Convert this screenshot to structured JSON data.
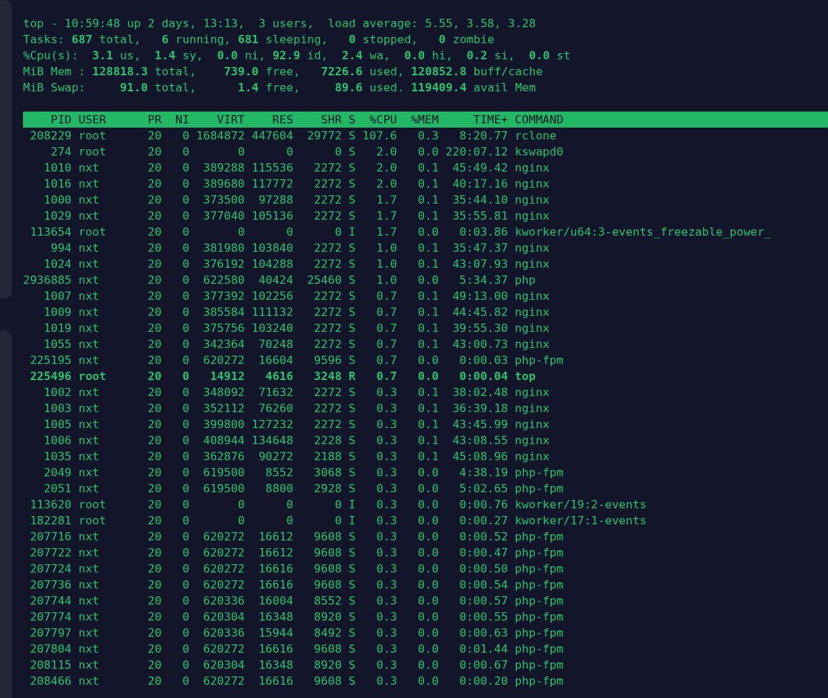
{
  "summary": [
    "top - 10:59:48 up 2 days, 13:13,  3 users,  load average: 5.55, 3.58, 3.28",
    "Tasks: **687** total,   **6** running, **681** sleeping,   **0** stopped,   **0** zombie",
    "%Cpu(s):  **3.1** us,  **1.4** sy,  **0.0** ni, **92.9** id,  **2.4** wa,  **0.0** hi,  **0.2** si,  **0.0** st",
    "MiB Mem : **128818.3** total,    **739.0** free,   **7226.6** used, **120852.8** buff/cache",
    "MiB Swap:     **91.0** total,      **1.4** free,     **89.6** used. **119409.4** avail Mem"
  ],
  "table": {
    "columns": [
      "PID",
      "USER",
      "PR",
      "NI",
      "VIRT",
      "RES",
      "SHR",
      "S",
      "%CPU",
      "%MEM",
      "TIME+",
      "COMMAND"
    ],
    "rows": [
      {
        "bold": false,
        "cells": [
          "208229",
          "root",
          "20",
          "0",
          "1684872",
          "447604",
          "29772",
          "S",
          "107.6",
          "0.3",
          "8:20.77",
          "rclone"
        ]
      },
      {
        "bold": false,
        "cells": [
          "274",
          "root",
          "20",
          "0",
          "0",
          "0",
          "0",
          "S",
          "2.0",
          "0.0",
          "220:07.12",
          "kswapd0"
        ]
      },
      {
        "bold": false,
        "cells": [
          "1010",
          "nxt",
          "20",
          "0",
          "389288",
          "115536",
          "2272",
          "S",
          "2.0",
          "0.1",
          "45:49.42",
          "nginx"
        ]
      },
      {
        "bold": false,
        "cells": [
          "1016",
          "nxt",
          "20",
          "0",
          "389680",
          "117772",
          "2272",
          "S",
          "2.0",
          "0.1",
          "40:17.16",
          "nginx"
        ]
      },
      {
        "bold": false,
        "cells": [
          "1000",
          "nxt",
          "20",
          "0",
          "373500",
          "97288",
          "2272",
          "S",
          "1.7",
          "0.1",
          "35:44.10",
          "nginx"
        ]
      },
      {
        "bold": false,
        "cells": [
          "1029",
          "nxt",
          "20",
          "0",
          "377040",
          "105136",
          "2272",
          "S",
          "1.7",
          "0.1",
          "35:55.81",
          "nginx"
        ]
      },
      {
        "bold": false,
        "cells": [
          "113654",
          "root",
          "20",
          "0",
          "0",
          "0",
          "0",
          "I",
          "1.7",
          "0.0",
          "0:03.86",
          "kworker/u64:3-events_freezable_power_"
        ]
      },
      {
        "bold": false,
        "cells": [
          "994",
          "nxt",
          "20",
          "0",
          "381980",
          "103840",
          "2272",
          "S",
          "1.0",
          "0.1",
          "35:47.37",
          "nginx"
        ]
      },
      {
        "bold": false,
        "cells": [
          "1024",
          "nxt",
          "20",
          "0",
          "376192",
          "104288",
          "2272",
          "S",
          "1.0",
          "0.1",
          "43:07.93",
          "nginx"
        ]
      },
      {
        "bold": false,
        "cells": [
          "2936885",
          "nxt",
          "20",
          "0",
          "622580",
          "40424",
          "25460",
          "S",
          "1.0",
          "0.0",
          "5:34.37",
          "php"
        ]
      },
      {
        "bold": false,
        "cells": [
          "1007",
          "nxt",
          "20",
          "0",
          "377392",
          "102256",
          "2272",
          "S",
          "0.7",
          "0.1",
          "49:13.00",
          "nginx"
        ]
      },
      {
        "bold": false,
        "cells": [
          "1009",
          "nxt",
          "20",
          "0",
          "385584",
          "111132",
          "2272",
          "S",
          "0.7",
          "0.1",
          "44:45.82",
          "nginx"
        ]
      },
      {
        "bold": false,
        "cells": [
          "1019",
          "nxt",
          "20",
          "0",
          "375756",
          "103240",
          "2272",
          "S",
          "0.7",
          "0.1",
          "39:55.30",
          "nginx"
        ]
      },
      {
        "bold": false,
        "cells": [
          "1055",
          "nxt",
          "20",
          "0",
          "342364",
          "70248",
          "2272",
          "S",
          "0.7",
          "0.1",
          "43:00.73",
          "nginx"
        ]
      },
      {
        "bold": false,
        "cells": [
          "225195",
          "nxt",
          "20",
          "0",
          "620272",
          "16604",
          "9596",
          "S",
          "0.7",
          "0.0",
          "0:00.03",
          "php-fpm"
        ]
      },
      {
        "bold": true,
        "cells": [
          "225496",
          "root",
          "20",
          "0",
          "14912",
          "4616",
          "3248",
          "R",
          "0.7",
          "0.0",
          "0:00.04",
          "top"
        ]
      },
      {
        "bold": false,
        "cells": [
          "1002",
          "nxt",
          "20",
          "0",
          "348092",
          "71632",
          "2272",
          "S",
          "0.3",
          "0.1",
          "38:02.48",
          "nginx"
        ]
      },
      {
        "bold": false,
        "cells": [
          "1003",
          "nxt",
          "20",
          "0",
          "352112",
          "76260",
          "2272",
          "S",
          "0.3",
          "0.1",
          "36:39.18",
          "nginx"
        ]
      },
      {
        "bold": false,
        "cells": [
          "1005",
          "nxt",
          "20",
          "0",
          "399800",
          "127232",
          "2272",
          "S",
          "0.3",
          "0.1",
          "43:45.99",
          "nginx"
        ]
      },
      {
        "bold": false,
        "cells": [
          "1006",
          "nxt",
          "20",
          "0",
          "408944",
          "134648",
          "2228",
          "S",
          "0.3",
          "0.1",
          "43:08.55",
          "nginx"
        ]
      },
      {
        "bold": false,
        "cells": [
          "1035",
          "nxt",
          "20",
          "0",
          "362876",
          "90272",
          "2188",
          "S",
          "0.3",
          "0.1",
          "45:08.96",
          "nginx"
        ]
      },
      {
        "bold": false,
        "cells": [
          "2049",
          "nxt",
          "20",
          "0",
          "619500",
          "8552",
          "3068",
          "S",
          "0.3",
          "0.0",
          "4:38.19",
          "php-fpm"
        ]
      },
      {
        "bold": false,
        "cells": [
          "2051",
          "nxt",
          "20",
          "0",
          "619500",
          "8800",
          "2928",
          "S",
          "0.3",
          "0.0",
          "5:02.65",
          "php-fpm"
        ]
      },
      {
        "bold": false,
        "cells": [
          "113620",
          "root",
          "20",
          "0",
          "0",
          "0",
          "0",
          "I",
          "0.3",
          "0.0",
          "0:00.76",
          "kworker/19:2-events"
        ]
      },
      {
        "bold": false,
        "cells": [
          "182281",
          "root",
          "20",
          "0",
          "0",
          "0",
          "0",
          "I",
          "0.3",
          "0.0",
          "0:00.27",
          "kworker/17:1-events"
        ]
      },
      {
        "bold": false,
        "cells": [
          "207716",
          "nxt",
          "20",
          "0",
          "620272",
          "16612",
          "9608",
          "S",
          "0.3",
          "0.0",
          "0:00.52",
          "php-fpm"
        ]
      },
      {
        "bold": false,
        "cells": [
          "207722",
          "nxt",
          "20",
          "0",
          "620272",
          "16612",
          "9608",
          "S",
          "0.3",
          "0.0",
          "0:00.47",
          "php-fpm"
        ]
      },
      {
        "bold": false,
        "cells": [
          "207724",
          "nxt",
          "20",
          "0",
          "620272",
          "16616",
          "9608",
          "S",
          "0.3",
          "0.0",
          "0:00.50",
          "php-fpm"
        ]
      },
      {
        "bold": false,
        "cells": [
          "207736",
          "nxt",
          "20",
          "0",
          "620272",
          "16616",
          "9608",
          "S",
          "0.3",
          "0.0",
          "0:00.54",
          "php-fpm"
        ]
      },
      {
        "bold": false,
        "cells": [
          "207744",
          "nxt",
          "20",
          "0",
          "620336",
          "16004",
          "8552",
          "S",
          "0.3",
          "0.0",
          "0:00.57",
          "php-fpm"
        ]
      },
      {
        "bold": false,
        "cells": [
          "207774",
          "nxt",
          "20",
          "0",
          "620304",
          "16348",
          "8920",
          "S",
          "0.3",
          "0.0",
          "0:00.55",
          "php-fpm"
        ]
      },
      {
        "bold": false,
        "cells": [
          "207797",
          "nxt",
          "20",
          "0",
          "620336",
          "15944",
          "8492",
          "S",
          "0.3",
          "0.0",
          "0:00.63",
          "php-fpm"
        ]
      },
      {
        "bold": false,
        "cells": [
          "207804",
          "nxt",
          "20",
          "0",
          "620272",
          "16616",
          "9608",
          "S",
          "0.3",
          "0.0",
          "0:01.44",
          "php-fpm"
        ]
      },
      {
        "bold": false,
        "cells": [
          "208115",
          "nxt",
          "20",
          "0",
          "620304",
          "16348",
          "8920",
          "S",
          "0.3",
          "0.0",
          "0:00.67",
          "php-fpm"
        ]
      },
      {
        "bold": false,
        "cells": [
          "208466",
          "nxt",
          "20",
          "0",
          "620272",
          "16616",
          "9608",
          "S",
          "0.3",
          "0.0",
          "0:00.20",
          "php-fpm"
        ]
      }
    ]
  }
}
